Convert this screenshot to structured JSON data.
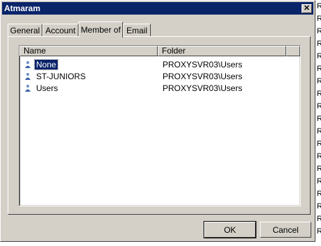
{
  "window": {
    "title": "Atmaram",
    "close_glyph": "✕"
  },
  "tabs": [
    {
      "label": "General",
      "active": false
    },
    {
      "label": "Account",
      "active": false
    },
    {
      "label": "Member of",
      "active": true
    },
    {
      "label": "Email",
      "active": false
    }
  ],
  "list": {
    "columns": [
      "Name",
      "Folder"
    ],
    "rows": [
      {
        "name": "None",
        "folder": "PROXYSVR03\\Users",
        "selected": true,
        "icon": "group-icon"
      },
      {
        "name": "ST-JUNIORS",
        "folder": "PROXYSVR03\\Users",
        "selected": false,
        "icon": "group-icon"
      },
      {
        "name": "Users",
        "folder": "PROXYSVR03\\Users",
        "selected": false,
        "icon": "group-icon"
      }
    ]
  },
  "buttons": {
    "ok": "OK",
    "cancel": "Cancel"
  },
  "colors": {
    "titlebar": "#0a246a",
    "face": "#d4d0c8",
    "selection": "#0a246a"
  }
}
